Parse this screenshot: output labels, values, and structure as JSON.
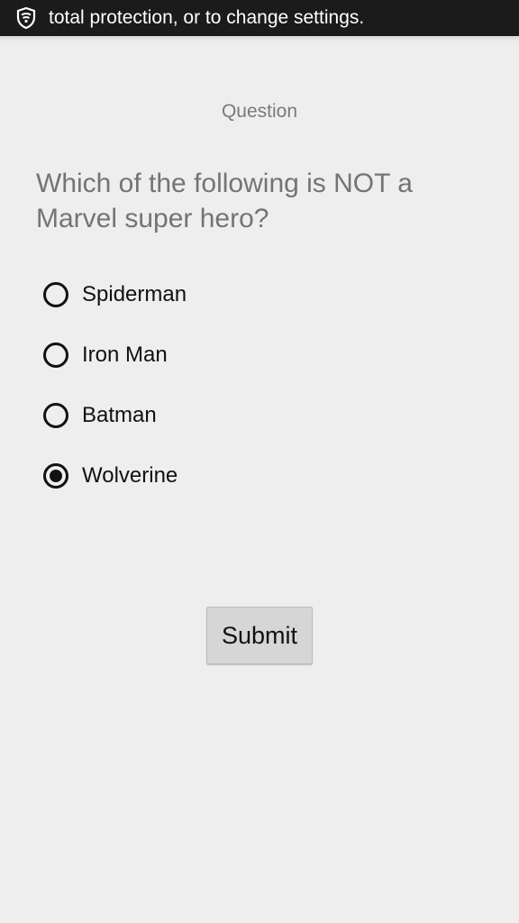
{
  "status_bar": {
    "icon": "shield-icon",
    "text": "total protection, or to change settings."
  },
  "quiz": {
    "label": "Question",
    "question": "Which of the following is NOT a Marvel super hero?",
    "options": [
      {
        "label": "Spiderman",
        "selected": false
      },
      {
        "label": "Iron Man",
        "selected": false
      },
      {
        "label": "Batman",
        "selected": false
      },
      {
        "label": "Wolverine",
        "selected": true
      }
    ],
    "submit_label": "Submit"
  },
  "colors": {
    "background": "#eeeeee",
    "status_bar": "#1b1b1b",
    "button": "#d6d6d6"
  }
}
